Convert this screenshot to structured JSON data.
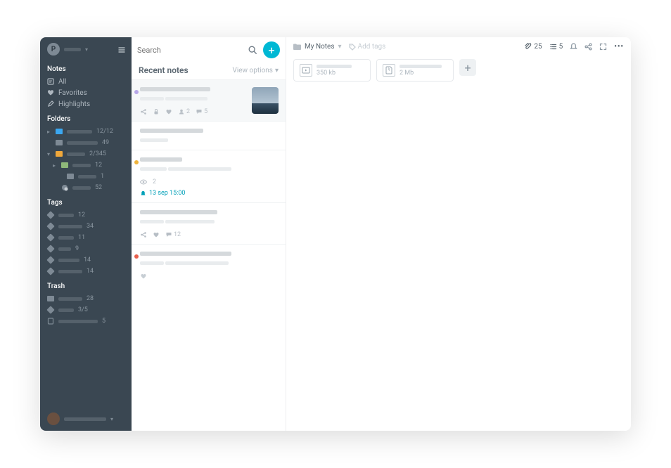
{
  "user": {
    "initial": "P"
  },
  "nav": {
    "notes_title": "Notes",
    "items": [
      {
        "icon": "note",
        "label": "All"
      },
      {
        "icon": "heart",
        "label": "Favorites"
      },
      {
        "icon": "highlight",
        "label": "Highlights"
      }
    ],
    "folders_title": "Folders",
    "folders": [
      {
        "color": "#3ba7f0",
        "count": "12/12",
        "caret": "▸"
      },
      {
        "color": "#7e8a95",
        "count": "49"
      },
      {
        "color": "#f0a83b",
        "count": "2/345",
        "caret": "▾",
        "children": [
          {
            "color": "#8fb87a",
            "count": "12",
            "caret": "▸",
            "indent": 1
          },
          {
            "color": "#7e8a95",
            "count": "1",
            "indent": 2
          },
          {
            "icon": "badge",
            "count": "52",
            "indent": 1
          }
        ]
      }
    ],
    "tags_title": "Tags",
    "tags": [
      {
        "count": "12"
      },
      {
        "count": "34"
      },
      {
        "count": "11"
      },
      {
        "count": "9"
      },
      {
        "count": "14"
      },
      {
        "count": "14"
      }
    ],
    "trash_title": "Trash",
    "trash": [
      {
        "icon": "folder",
        "count": "28"
      },
      {
        "icon": "tag",
        "count": "3/5"
      },
      {
        "icon": "note",
        "count": "5"
      }
    ]
  },
  "search": {
    "placeholder": "Search"
  },
  "list": {
    "title": "Recent notes",
    "view_options": "View options",
    "cards": [
      {
        "dot": "#b7a7e8",
        "selected": true,
        "thumb": true,
        "meta": {
          "contacts": "2",
          "comments": "5"
        }
      },
      {
        "dot": null
      },
      {
        "dot": "#f0b43b",
        "meta": {
          "views": "2"
        },
        "reminder": "13 sep 15:00"
      },
      {
        "dot": null,
        "meta": {
          "comments": "12"
        }
      },
      {
        "dot": "#e85f4c",
        "meta": {
          "fav": true
        }
      }
    ]
  },
  "editor": {
    "breadcrumb": "My Notes",
    "add_tags": "Add tags",
    "stats": {
      "attachments": "25",
      "todos": "5"
    },
    "attachments": [
      {
        "type": "video",
        "size": "350 kb"
      },
      {
        "type": "archive",
        "size": "2 Mb"
      }
    ]
  }
}
